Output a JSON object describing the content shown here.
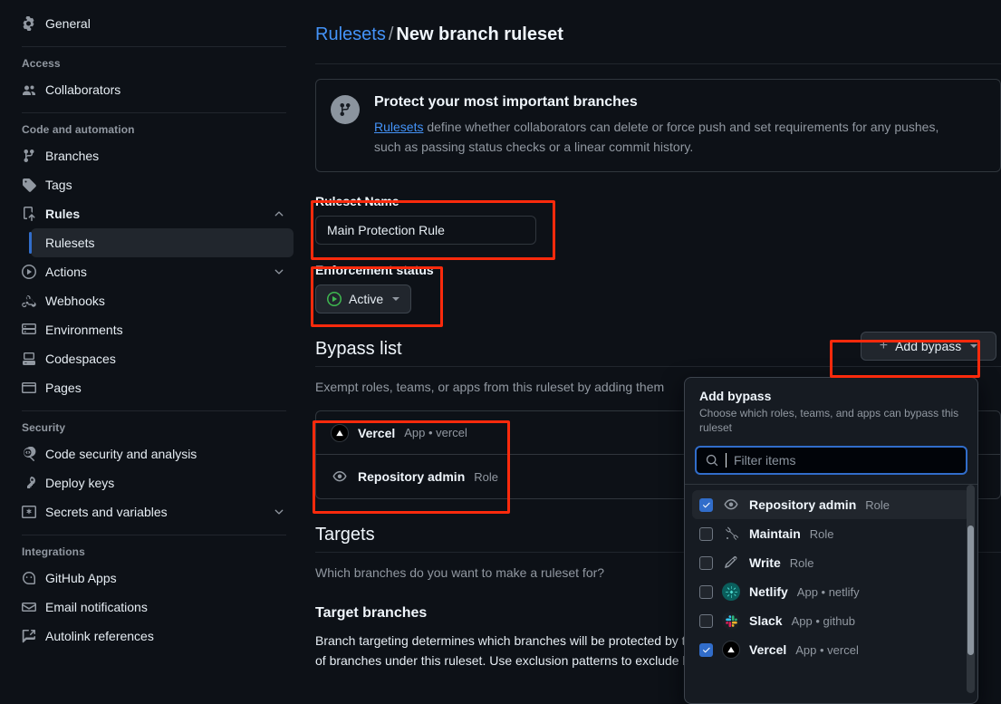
{
  "sidebar": {
    "groups": [
      {
        "heading": null,
        "items": [
          {
            "label": "General",
            "icon": "gear-icon"
          }
        ]
      },
      {
        "heading": "Access",
        "items": [
          {
            "label": "Collaborators",
            "icon": "people-icon"
          }
        ]
      },
      {
        "heading": "Code and automation",
        "items": [
          {
            "label": "Branches",
            "icon": "git-branch-icon"
          },
          {
            "label": "Tags",
            "icon": "tag-icon"
          },
          {
            "label": "Rules",
            "icon": "rules-icon",
            "expanded": true,
            "chevron": "chevron-up-icon",
            "children": [
              {
                "label": "Rulesets",
                "selected": true
              }
            ]
          },
          {
            "label": "Actions",
            "icon": "play-circle-icon",
            "chevron": "chevron-down-icon"
          },
          {
            "label": "Webhooks",
            "icon": "webhook-icon"
          },
          {
            "label": "Environments",
            "icon": "server-icon"
          },
          {
            "label": "Codespaces",
            "icon": "codespaces-icon"
          },
          {
            "label": "Pages",
            "icon": "browser-icon"
          }
        ]
      },
      {
        "heading": "Security",
        "items": [
          {
            "label": "Code security and analysis",
            "icon": "code-scan-icon"
          },
          {
            "label": "Deploy keys",
            "icon": "key-icon"
          },
          {
            "label": "Secrets and variables",
            "icon": "asterisk-icon",
            "chevron": "chevron-down-icon"
          }
        ]
      },
      {
        "heading": "Integrations",
        "items": [
          {
            "label": "GitHub Apps",
            "icon": "github-apps-icon"
          },
          {
            "label": "Email notifications",
            "icon": "mail-icon"
          },
          {
            "label": "Autolink references",
            "icon": "external-link-icon"
          }
        ]
      }
    ]
  },
  "breadcrumb": {
    "parent": "Rulesets",
    "separator": "/",
    "current": "New branch ruleset"
  },
  "banner": {
    "icon": "git-branch-icon",
    "title": "Protect your most important branches",
    "link_text": "Rulesets",
    "body": " define whether collaborators can delete or force push and set requirements for any pushes, such as passing status checks or a linear commit history."
  },
  "ruleset_name": {
    "label": "Ruleset Name",
    "value": "Main Protection Rule",
    "placeholder": ""
  },
  "enforcement": {
    "label": "Enforcement status",
    "value": "Active",
    "icon": "play-circle-icon",
    "color": "#3fb950"
  },
  "bypass": {
    "heading": "Bypass list",
    "description": "Exempt roles, teams, or apps from this ruleset by adding them",
    "add_button": {
      "label": "Add bypass",
      "plus": "plus-icon",
      "caret": "triangle-down-icon"
    },
    "rows": [
      {
        "name": "Vercel",
        "meta": "App • vercel",
        "icon": "vercel-icon"
      },
      {
        "name": "Repository admin",
        "meta": "Role",
        "icon": "eye-icon"
      }
    ]
  },
  "dropdown": {
    "title": "Add bypass",
    "subtitle": "Choose which roles, teams, and apps can bypass this ruleset",
    "search": {
      "placeholder": "Filter items",
      "value": "",
      "icon": "search-icon"
    },
    "items": [
      {
        "name": "Repository admin",
        "meta": "Role",
        "icon": "eye-icon",
        "checked": true,
        "active": true
      },
      {
        "name": "Maintain",
        "meta": "Role",
        "icon": "tools-icon",
        "checked": false,
        "active": false
      },
      {
        "name": "Write",
        "meta": "Role",
        "icon": "pencil-icon",
        "checked": false,
        "active": false
      },
      {
        "name": "Netlify",
        "meta": "App • netlify",
        "icon": "netlify-icon",
        "checked": false,
        "active": false
      },
      {
        "name": "Slack",
        "meta": "App • github",
        "icon": "slack-icon",
        "checked": false,
        "active": false
      },
      {
        "name": "Vercel",
        "meta": "App • vercel",
        "icon": "vercel-icon",
        "checked": true,
        "active": false
      }
    ]
  },
  "targets": {
    "heading": "Targets",
    "description": "Which branches do you want to make a ruleset for?",
    "subheading": "Target branches",
    "body": "Branch targeting determines which branches will be protected by this ruleset. Use inclusion patterns to expand the list of branches under this ruleset. Use exclusion patterns to exclude branches."
  },
  "colors": {
    "accent": "#4493f8",
    "selected_bar": "#316dca",
    "success": "#3fb950",
    "annotation": "#fc2a0c"
  }
}
